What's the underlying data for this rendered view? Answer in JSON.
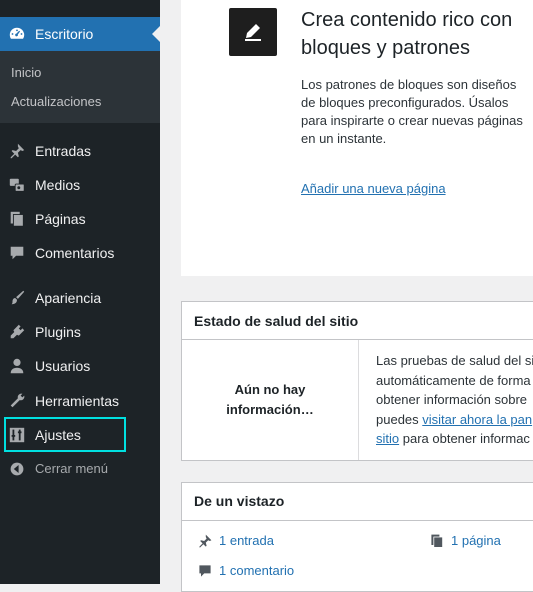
{
  "sidebar": {
    "active": {
      "label": "Escritorio",
      "icon": "dashboard-icon"
    },
    "submenu": [
      {
        "label": "Inicio"
      },
      {
        "label": "Actualizaciones"
      }
    ],
    "items": [
      {
        "label": "Entradas",
        "icon": "pin-icon"
      },
      {
        "label": "Medios",
        "icon": "media-icon"
      },
      {
        "label": "Páginas",
        "icon": "pages-icon"
      },
      {
        "label": "Comentarios",
        "icon": "comment-icon"
      },
      {
        "label": "Apariencia",
        "icon": "brush-icon"
      },
      {
        "label": "Plugins",
        "icon": "plugin-icon"
      },
      {
        "label": "Usuarios",
        "icon": "users-icon"
      },
      {
        "label": "Herramientas",
        "icon": "wrench-icon"
      },
      {
        "label": "Ajustes",
        "icon": "settings-icon"
      }
    ],
    "collapse": {
      "label": "Cerrar menú",
      "icon": "collapse-icon"
    },
    "highlight_color": "#00e0e0"
  },
  "welcome": {
    "title": "Crea contenido rico con bloques y patrones",
    "description": "Los patrones de bloques son diseños de bloques preconfigurados. Úsalos para inspirarte o crear nuevas páginas en un instante.",
    "link": "Añadir una nueva página",
    "icon": "pen-icon"
  },
  "health": {
    "title": "Estado de salud del sitio",
    "status_line1": "Aún no hay",
    "status_line2": "información…",
    "desc_line1": "Las pruebas de salud del sit",
    "desc_line2": "automáticamente de forma",
    "desc_line3": "obtener información sobre",
    "desc_prefix": "puedes ",
    "desc_link1": "visitar ahora la pan",
    "desc_link2": "sitio",
    "desc_suffix": " para obtener informac"
  },
  "glance": {
    "title": "De un vistazo",
    "posts": "1 entrada",
    "pages": "1 página",
    "comments": "1 comentario"
  },
  "colors": {
    "sidebar_bg": "#1d2327",
    "accent": "#2271b1",
    "background": "#f0f0f1"
  }
}
